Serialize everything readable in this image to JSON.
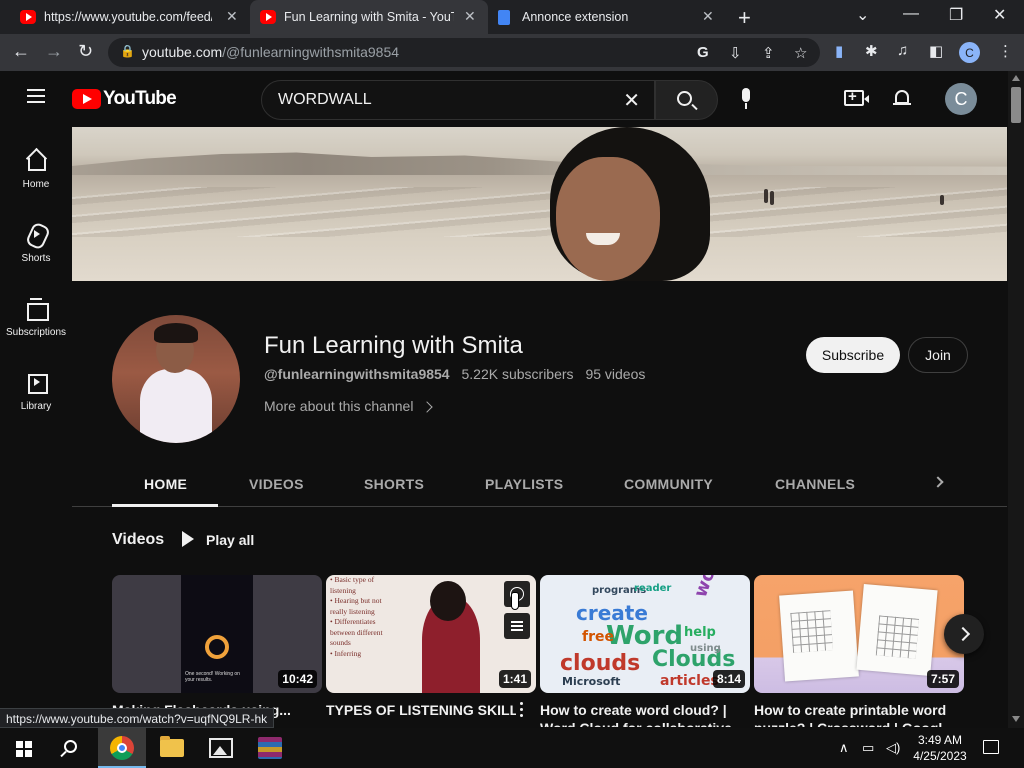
{
  "browser": {
    "tabs": [
      {
        "title": "https://www.youtube.com/feed/li",
        "icon": "youtube-icon"
      },
      {
        "title": "Fun Learning with Smita - YouTub",
        "icon": "youtube-icon",
        "active": true
      },
      {
        "title": "Annonce extension",
        "icon": "docs-icon"
      }
    ],
    "address": {
      "host": "youtube.com",
      "path": "/@funlearningwithsmita9854"
    },
    "profile_initial": "C",
    "status_url": "https://www.youtube.com/watch?v=uqfNQ9LR-hk"
  },
  "youtube": {
    "logo_text": "YouTube",
    "search_query": "WORDWALL",
    "avatar_initial": "C",
    "sidebar": [
      {
        "label": "Home",
        "icon": "home-icon"
      },
      {
        "label": "Shorts",
        "icon": "shorts-icon"
      },
      {
        "label": "Subscriptions",
        "icon": "subscriptions-icon"
      },
      {
        "label": "Library",
        "icon": "library-icon"
      }
    ],
    "channel": {
      "name": "Fun Learning with Smita",
      "handle": "@funlearningwithsmita9854",
      "subscribers": "5.22K subscribers",
      "videos": "95 videos",
      "more": "More about this channel",
      "subscribe_label": "Subscribe",
      "join_label": "Join"
    },
    "tabs": [
      "HOME",
      "VIDEOS",
      "SHORTS",
      "PLAYLISTS",
      "COMMUNITY",
      "CHANNELS"
    ],
    "section": {
      "title": "Videos",
      "play_all": "Play all"
    },
    "videos": [
      {
        "title": "Making Flashcards using...",
        "title2": "",
        "duration": "10:42",
        "thumb_caption": "One second! Working on your results."
      },
      {
        "title": "TYPES OF LISTENING SKILLS",
        "title2": "",
        "duration": "1:41",
        "thumb_text": [
          "• Basic type of",
          "listening",
          "• Hearing but not",
          "really listening",
          "• Differentiates",
          "between different",
          "sounds",
          "• Inferring"
        ]
      },
      {
        "title": "How to create word cloud? |",
        "title2": "Word Cloud for collaborative",
        "duration": "8:14",
        "cloud_words": [
          "create",
          "Word",
          "clouds",
          "Clouds",
          "word",
          "free",
          "articles",
          "Microsoft",
          "help",
          "programs",
          "using",
          "reader"
        ]
      },
      {
        "title": "How to create printable word",
        "title2": "puzzle? | Crossword | Googl",
        "duration": "7:57"
      }
    ]
  },
  "taskbar": {
    "time": "3:49 AM",
    "date": "4/25/2023"
  },
  "colors": {
    "yt_red": "#ff0000",
    "background": "#0f0f0f",
    "chrome_toolbar": "#35363a"
  }
}
